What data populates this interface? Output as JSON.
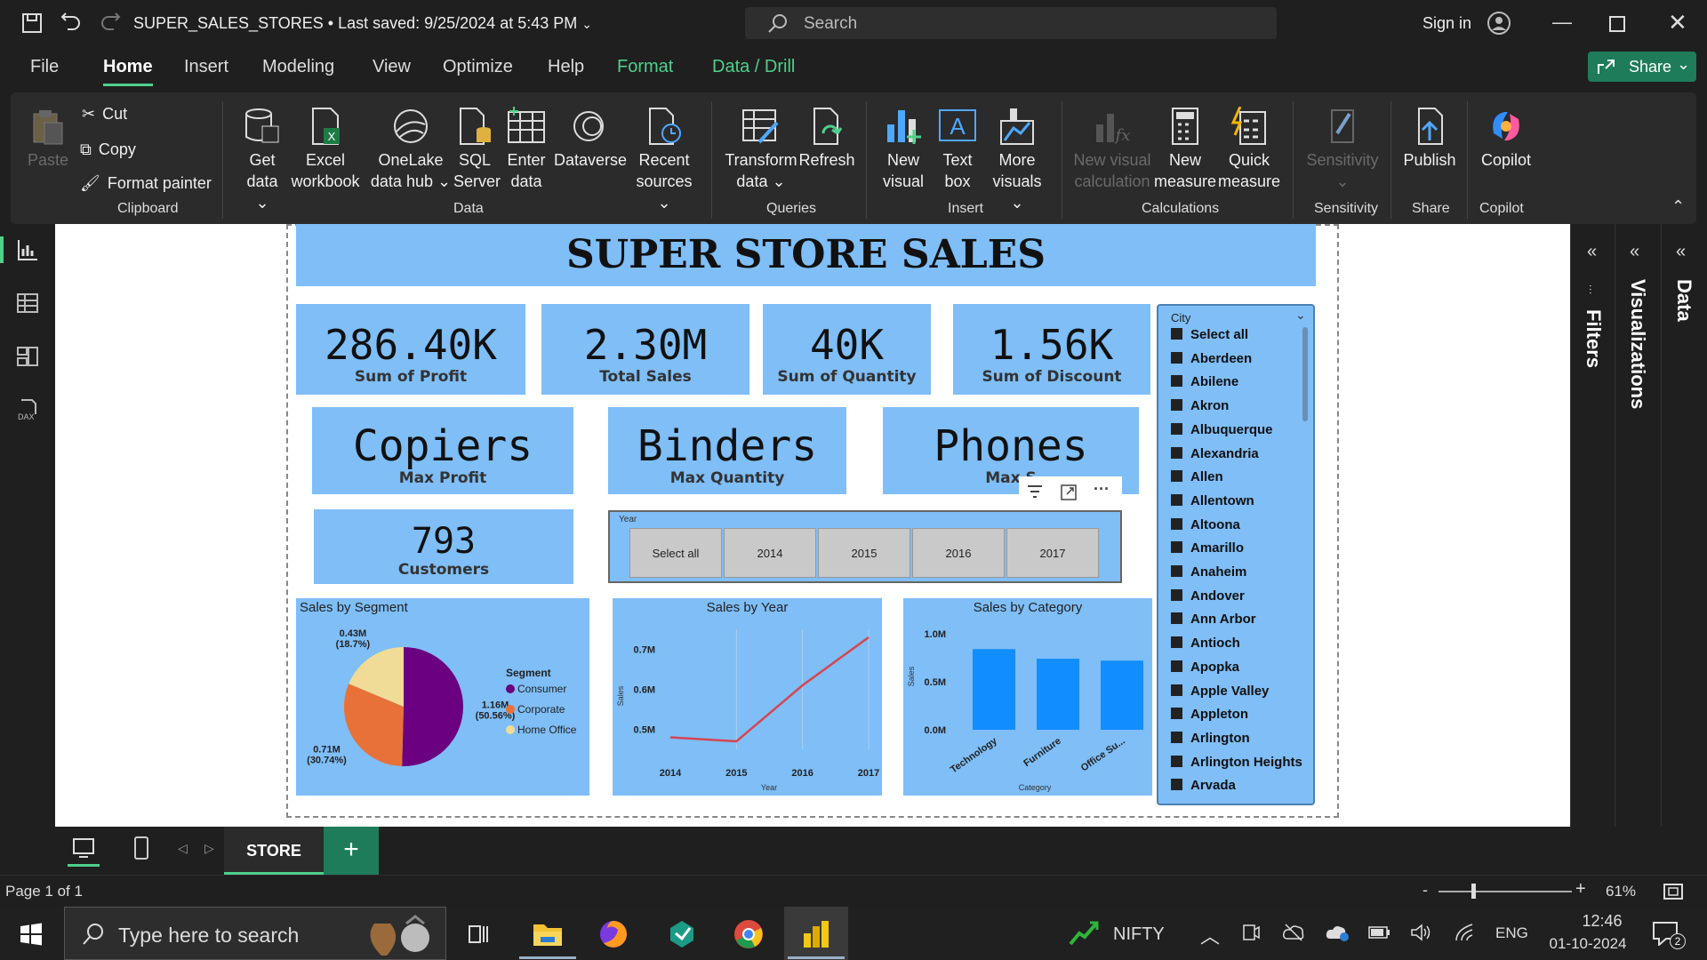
{
  "titlebar": {
    "doc_title": "SUPER_SALES_STORES • Last saved: 9/25/2024 at 5:43 PM",
    "search_placeholder": "Search",
    "signin": "Sign in"
  },
  "menu": {
    "items": [
      "File",
      "Home",
      "Insert",
      "Modeling",
      "View",
      "Optimize",
      "Help",
      "Format",
      "Data / Drill"
    ],
    "share": "Share"
  },
  "ribbon": {
    "clipboard": {
      "paste": "Paste",
      "cut": "Cut",
      "copy": "Copy",
      "format_painter": "Format painter",
      "group": "Clipboard"
    },
    "data": {
      "get_data": [
        "Get",
        "data"
      ],
      "excel": [
        "Excel",
        "workbook"
      ],
      "onelake": [
        "OneLake",
        "data hub"
      ],
      "sql": [
        "SQL",
        "Server"
      ],
      "enter": [
        "Enter",
        "data"
      ],
      "dataverse": "Dataverse",
      "recent": [
        "Recent",
        "sources"
      ],
      "group": "Data"
    },
    "queries": {
      "transform": [
        "Transform",
        "data"
      ],
      "refresh": "Refresh",
      "group": "Queries"
    },
    "insert": {
      "new_visual": [
        "New",
        "visual"
      ],
      "text_box": [
        "Text",
        "box"
      ],
      "more_visuals": [
        "More",
        "visuals"
      ],
      "group": "Insert"
    },
    "calculations": {
      "new_visual_calc": [
        "New visual",
        "calculation"
      ],
      "new_measure": [
        "New",
        "measure"
      ],
      "quick_measure": [
        "Quick",
        "measure"
      ],
      "group": "Calculations"
    },
    "sensitivity": {
      "label": "Sensitivity",
      "group": "Sensitivity"
    },
    "share": {
      "publish": "Publish",
      "group": "Share"
    },
    "copilot": {
      "label": "Copilot",
      "group": "Copilot"
    }
  },
  "report": {
    "title": "SUPER STORE SALES",
    "kpis": [
      {
        "value": "286.40K",
        "label": "Sum of Profit"
      },
      {
        "value": "2.30M",
        "label": "Total Sales"
      },
      {
        "value": "40K",
        "label": "Sum of Quantity"
      },
      {
        "value": "1.56K",
        "label": "Sum of Discount"
      }
    ],
    "cards": [
      {
        "value": "Copiers",
        "label": "Max Profit"
      },
      {
        "value": "Binders",
        "label": "Max Quantity"
      },
      {
        "value": "Phones",
        "label": "Max S"
      }
    ],
    "customers": {
      "value": "793",
      "label": "Customers"
    },
    "year_slicer": {
      "title": "Year",
      "options": [
        "Select all",
        "2014",
        "2015",
        "2016",
        "2017"
      ]
    },
    "city_slicer": {
      "title": "City",
      "items": [
        "Select all",
        "Aberdeen",
        "Abilene",
        "Akron",
        "Albuquerque",
        "Alexandria",
        "Allen",
        "Allentown",
        "Altoona",
        "Amarillo",
        "Anaheim",
        "Andover",
        "Ann Arbor",
        "Antioch",
        "Apopka",
        "Apple Valley",
        "Appleton",
        "Arlington",
        "Arlington Heights",
        "Arvada"
      ]
    }
  },
  "chart_data": [
    {
      "type": "pie",
      "title": "Sales by Segment",
      "legend_title": "Segment",
      "legend_position": "right",
      "slices": [
        {
          "name": "Consumer",
          "value": 1.16,
          "label": "1.16M",
          "pct": "(50.56%)",
          "color": "#6b0080"
        },
        {
          "name": "Corporate",
          "value": 0.71,
          "label": "0.71M",
          "pct": "(30.74%)",
          "color": "#e8713a"
        },
        {
          "name": "Home Office",
          "value": 0.43,
          "label": "0.43M",
          "pct": "(18.7%)",
          "color": "#f0dc96"
        }
      ]
    },
    {
      "type": "line",
      "title": "Sales by Year",
      "xlabel": "Year",
      "ylabel": "Sales",
      "x": [
        "2014",
        "2015",
        "2016",
        "2017"
      ],
      "values": [
        0.48,
        0.47,
        0.61,
        0.73
      ],
      "yticks": [
        "0.5M",
        "0.6M",
        "0.7M"
      ],
      "ytick_values": [
        0.5,
        0.6,
        0.7
      ],
      "ylim": [
        0.45,
        0.75
      ],
      "color": "#d64550"
    },
    {
      "type": "bar",
      "title": "Sales by Category",
      "xlabel": "Category",
      "ylabel": "Sales",
      "categories": [
        "Technology",
        "Furniture",
        "Office Su..."
      ],
      "values": [
        0.84,
        0.74,
        0.72
      ],
      "yticks": [
        "0.0M",
        "0.5M",
        "1.0M"
      ],
      "ytick_values": [
        0,
        0.5,
        1.0
      ],
      "ylim": [
        0,
        1.0
      ],
      "color": "#118dff"
    }
  ],
  "panes": {
    "filters": "Filters",
    "visualizations": "Visualizations",
    "data": "Data"
  },
  "tabs": {
    "page_tab": "STORE"
  },
  "status": {
    "page": "Page 1 of 1",
    "zoom": "61%"
  },
  "taskbar": {
    "search_placeholder": "Type here to search",
    "nifty": "NIFTY",
    "lang": "ENG",
    "time": "12:46",
    "date": "01-10-2024",
    "notif_count": "2"
  }
}
